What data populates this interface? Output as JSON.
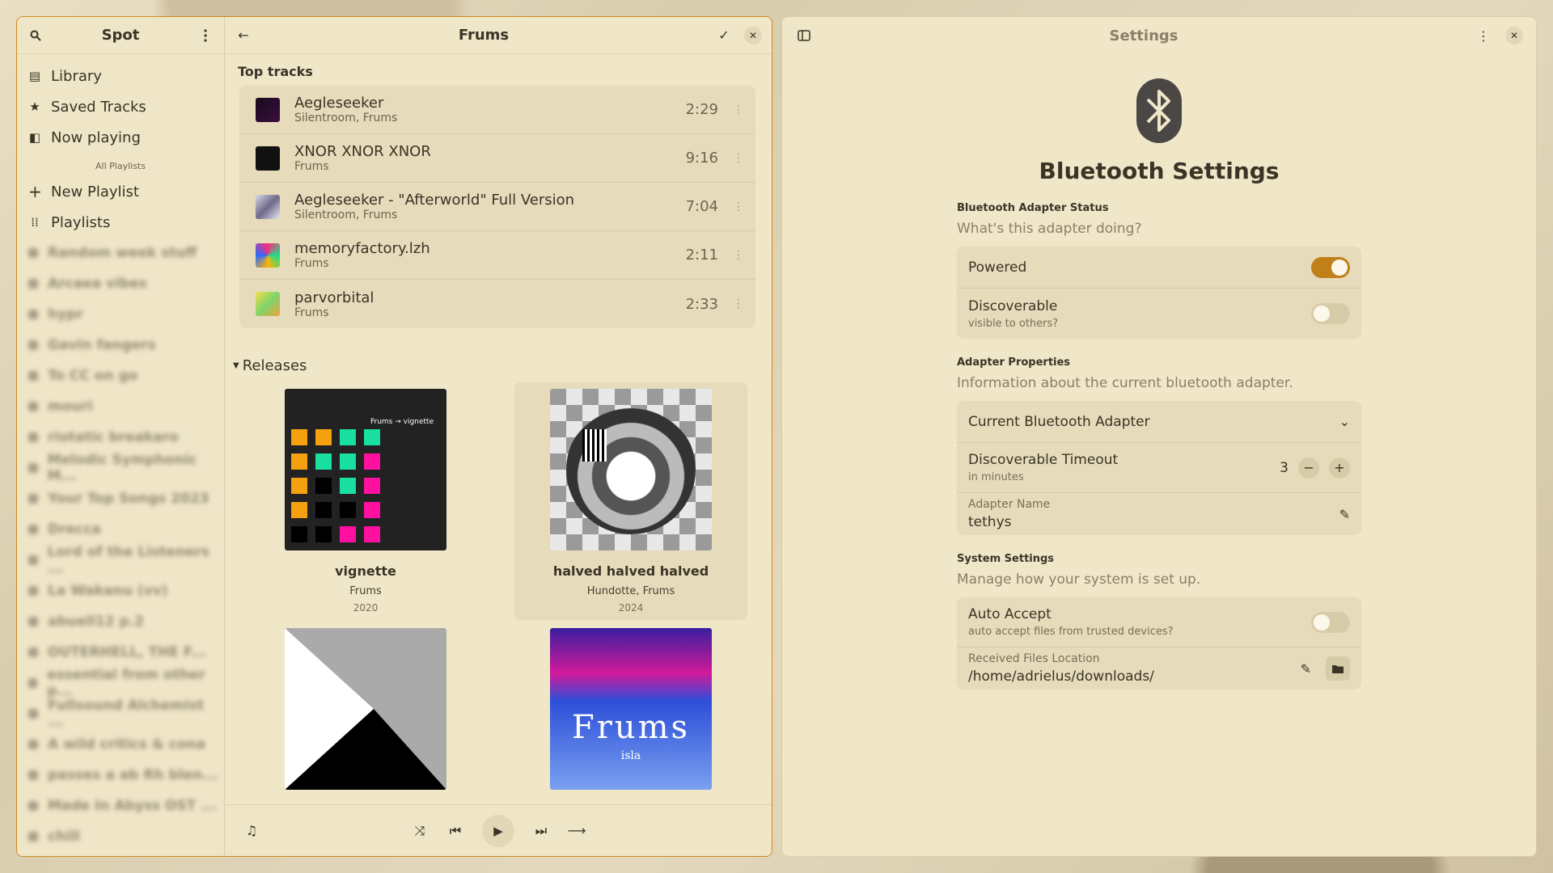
{
  "spot": {
    "app_title": "Spot",
    "sidebar": {
      "items": [
        {
          "label": "Library",
          "icon": "library-icon"
        },
        {
          "label": "Saved Tracks",
          "icon": "star-icon"
        },
        {
          "label": "Now playing",
          "icon": "now-playing-icon"
        }
      ],
      "section_label": "All Playlists",
      "playlist_actions": [
        {
          "label": "New Playlist",
          "icon": "plus-icon"
        },
        {
          "label": "Playlists",
          "icon": "grid-icon"
        }
      ],
      "blurred_playlists": [
        "Random week stuff",
        "Arcaea vibes",
        "hypr",
        "Gavin fangers",
        "To CC on go",
        "mouri",
        "riotatic breakaro",
        "Melodic Symphonic M...",
        "Your Top Songs 2023",
        "Drecca",
        "Lord of the Listeners ...",
        "La Wakanu (vv)",
        "abuell12 p.2",
        "OUTERHELL, THE F...",
        "essential from other p...",
        "Fullsound Alchemist ...",
        "A wild critics & cona",
        "passes a ab Rh blen...",
        "Made In Abyss OST ...",
        "chill"
      ]
    },
    "main": {
      "title": "Frums",
      "top_tracks_label": "Top tracks",
      "tracks": [
        {
          "name": "Aegleseeker",
          "artist": "Silentroom, Frums",
          "duration": "2:29"
        },
        {
          "name": "XNOR XNOR XNOR",
          "artist": "Frums",
          "duration": "9:16"
        },
        {
          "name": "Aegleseeker - \"Afterworld\" Full Version",
          "artist": "Silentroom, Frums",
          "duration": "7:04"
        },
        {
          "name": "memoryfactory.lzh",
          "artist": "Frums",
          "duration": "2:11"
        },
        {
          "name": "parvorbital",
          "artist": "Frums",
          "duration": "2:33"
        }
      ],
      "releases_label": "Releases",
      "releases": [
        {
          "name": "vignette",
          "artist": "Frums",
          "year": "2020",
          "cover_text": "Frums → vignette"
        },
        {
          "name": "halved halved halved",
          "artist": "Hundotte, Frums",
          "year": "2024"
        },
        {
          "name": "",
          "artist": "",
          "year": ""
        },
        {
          "name": "",
          "artist": "",
          "year": "",
          "cover_text": "Frums",
          "cover_sub": "isla"
        }
      ]
    },
    "player": {
      "icons": [
        "music-note-icon",
        "shuffle-icon",
        "previous-icon",
        "play-icon",
        "next-icon",
        "repeat-icon"
      ]
    }
  },
  "settings": {
    "title": "Settings",
    "heading": "Bluetooth Settings",
    "adapter_status": {
      "title": "Bluetooth Adapter Status",
      "desc": "What's this adapter doing?",
      "powered_label": "Powered",
      "powered": true,
      "discoverable_label": "Discoverable",
      "discoverable_sub": "visible to others?",
      "discoverable": false
    },
    "adapter_props": {
      "title": "Adapter Properties",
      "desc": "Information about the current bluetooth adapter.",
      "current_adapter_label": "Current Bluetooth Adapter",
      "timeout_label": "Discoverable Timeout",
      "timeout_sub": "in minutes",
      "timeout_value": "3",
      "name_label": "Adapter Name",
      "name_value": "tethys"
    },
    "system": {
      "title": "System Settings",
      "desc": "Manage how your system is set up.",
      "auto_accept_label": "Auto Accept",
      "auto_accept_sub": "auto accept files from trusted devices?",
      "auto_accept": false,
      "files_location_label": "Received Files Location",
      "files_location_value": "/home/adrielus/downloads/"
    }
  },
  "colors": {
    "accent": "#c17f19",
    "window_bg": "#f0e6c8",
    "card_bg": "#e6dbba"
  }
}
